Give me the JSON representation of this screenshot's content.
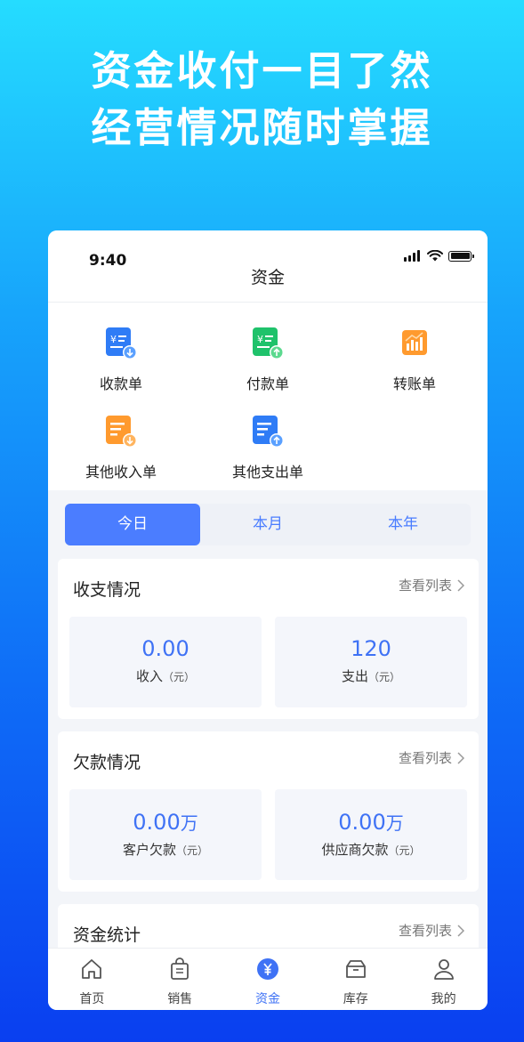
{
  "headline": {
    "line1": "资金收付一目了然",
    "line2": "经营情况随时掌握"
  },
  "status_bar": {
    "time": "9:40"
  },
  "header": {
    "title": "资金"
  },
  "menu": {
    "items": [
      {
        "label": "收款单",
        "icon": "receipt-icon"
      },
      {
        "label": "付款单",
        "icon": "payment-icon"
      },
      {
        "label": "转账单",
        "icon": "transfer-icon"
      },
      {
        "label": "其他收入单",
        "icon": "other-income-icon"
      },
      {
        "label": "其他支出单",
        "icon": "other-expense-icon"
      }
    ]
  },
  "period_tabs": {
    "items": [
      "今日",
      "本月",
      "本年"
    ],
    "active": "今日"
  },
  "income_card": {
    "title": "收支情况",
    "link": "查看列表",
    "income": {
      "value": "0.00",
      "label": "收入",
      "unit": "（元）"
    },
    "expense": {
      "value": "120",
      "label": "支出",
      "unit": "（元）"
    }
  },
  "debt_card": {
    "title": "欠款情况",
    "link": "查看列表",
    "customer": {
      "value": "0.00",
      "suffix": "万",
      "label": "客户欠款",
      "unit": "（元）"
    },
    "supplier": {
      "value": "0.00",
      "suffix": "万",
      "label": "供应商欠款",
      "unit": "（元）"
    }
  },
  "fund_card": {
    "title": "资金统计",
    "link": "查看列表"
  },
  "tabbar": {
    "items": [
      {
        "label": "首页",
        "icon": "home-icon"
      },
      {
        "label": "销售",
        "icon": "sales-bag-icon"
      },
      {
        "label": "资金",
        "icon": "yuan-icon"
      },
      {
        "label": "库存",
        "icon": "inventory-icon"
      },
      {
        "label": "我的",
        "icon": "user-icon"
      }
    ],
    "active": "资金"
  },
  "colors": {
    "accent": "#4b7dff",
    "value_blue": "#3f72f5",
    "receipt_icon": "#2f7cf6",
    "payment_icon": "#1fc26b",
    "transfer_icon": "#ff9a2e",
    "income_icon": "#ff9a2e",
    "expense_icon": "#2f7cf6"
  }
}
